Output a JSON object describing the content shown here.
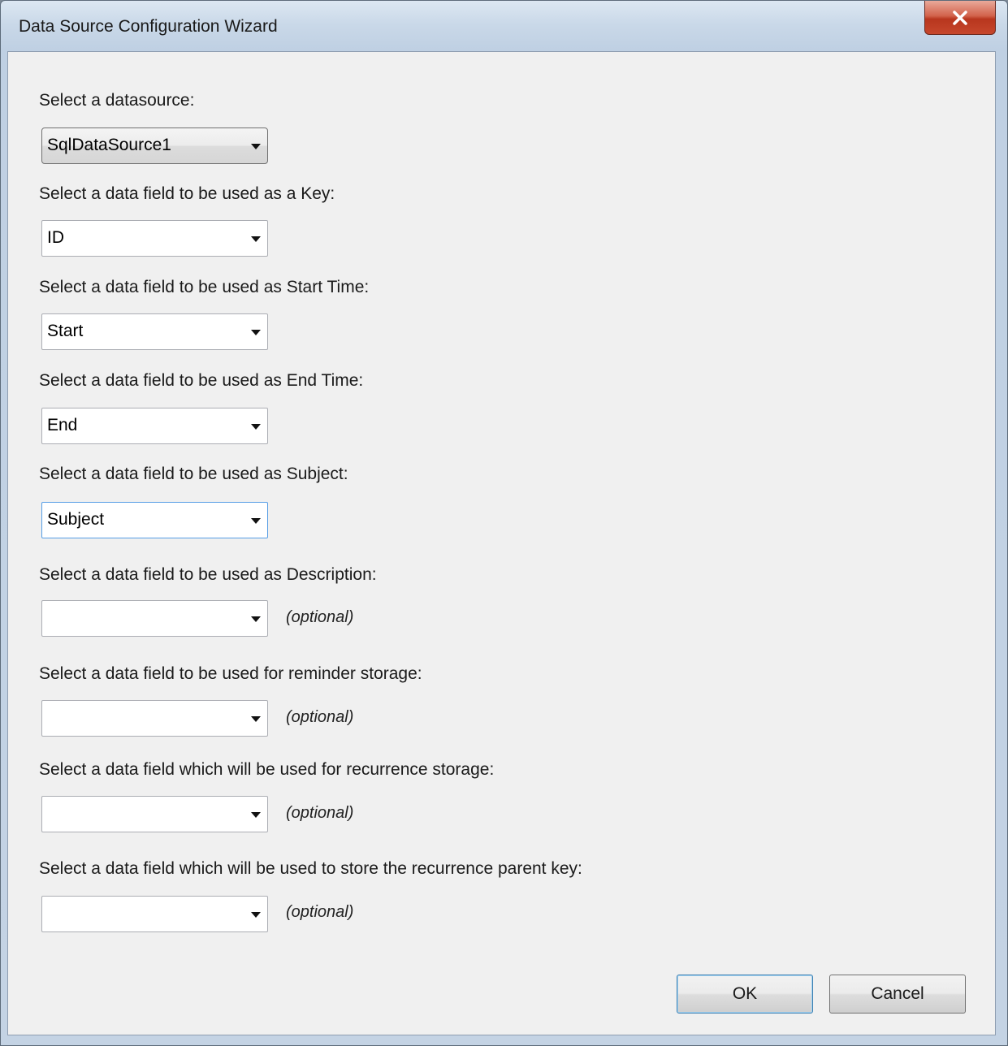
{
  "window": {
    "title": "Data Source Configuration Wizard",
    "close_icon": "close-x-icon"
  },
  "fields": [
    {
      "label": "Select a datasource:",
      "value": "SqlDataSource1",
      "optional": ""
    },
    {
      "label": "Select a data field to be used as a Key:",
      "value": "ID",
      "optional": ""
    },
    {
      "label": "Select a data field to be used as Start Time:",
      "value": "Start",
      "optional": ""
    },
    {
      "label": "Select a data field to be used as End Time:",
      "value": "End",
      "optional": ""
    },
    {
      "label": "Select a data field to be used as Subject:",
      "value": "Subject",
      "optional": ""
    },
    {
      "label": "Select a data field to be used as Description:",
      "value": "",
      "optional": "(optional)"
    },
    {
      "label": "Select a data field to be used for reminder storage:",
      "value": "",
      "optional": "(optional)"
    },
    {
      "label": "Select a data field which will be used for recurrence storage:",
      "value": "",
      "optional": "(optional)"
    },
    {
      "label": "Select a data field which will be used to store the recurrence parent key:",
      "value": "",
      "optional": "(optional)"
    }
  ],
  "buttons": {
    "ok": "OK",
    "cancel": "Cancel"
  }
}
